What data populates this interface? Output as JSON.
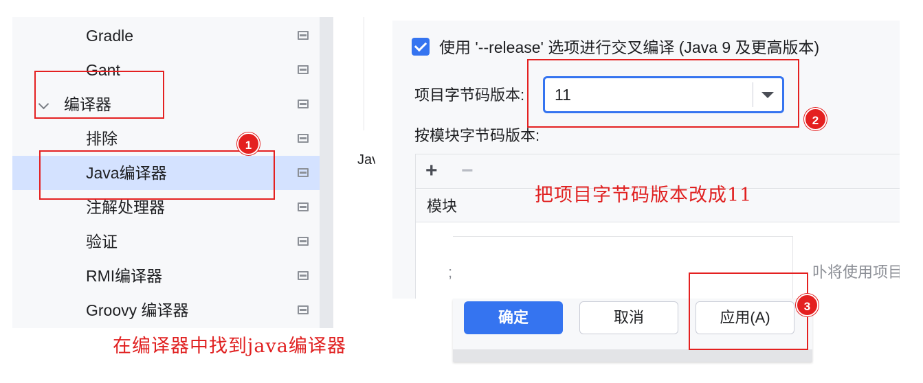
{
  "tree": {
    "items": [
      {
        "label": "Gradle",
        "indent": 2,
        "selected": false,
        "icon": "page-icon"
      },
      {
        "label": "Gant",
        "indent": 2,
        "selected": false,
        "icon": "page-icon"
      },
      {
        "label": "编译器",
        "indent": 1,
        "selected": false,
        "expanded": true,
        "icon": "page-icon"
      },
      {
        "label": "排除",
        "indent": 2,
        "selected": false,
        "icon": "page-icon"
      },
      {
        "label": "Java编译器",
        "indent": 2,
        "selected": true,
        "icon": "page-icon"
      },
      {
        "label": "注解处理器",
        "indent": 2,
        "selected": false,
        "icon": "page-icon"
      },
      {
        "label": "验证",
        "indent": 2,
        "selected": false,
        "icon": "page-icon"
      },
      {
        "label": "RMI编译器",
        "indent": 2,
        "selected": false,
        "icon": "page-icon"
      },
      {
        "label": "Groovy 编译器",
        "indent": 2,
        "selected": false,
        "icon": "page-icon"
      }
    ]
  },
  "middle": {
    "fragment": "Jav"
  },
  "settings": {
    "release_checkbox": {
      "checked": true,
      "label": "使用 '--release' 选项进行交叉编译 (Java 9 及更高版本)"
    },
    "target_label": "项目字节码版本:",
    "target_value": "11",
    "module_label": "按模块字节码版本:",
    "table": {
      "add_icon": "+",
      "remove_icon": "−",
      "column_header": "模块",
      "empty_text_fragment": "卟将使用项目",
      "left_fragment": ";"
    }
  },
  "dialog_buttons": {
    "ok": "确定",
    "cancel": "取消",
    "apply": "应用(A)"
  },
  "annotations": {
    "caption_left": "在编译器中找到java编译器",
    "caption_right": "把项目字节码版本改成11",
    "badges": [
      "1",
      "2",
      "3"
    ],
    "color": "#e42020"
  },
  "colors": {
    "accent": "#3574f0",
    "selection": "#d4e2ff",
    "panel": "#f7f8fa",
    "annotation": "#e02020"
  }
}
